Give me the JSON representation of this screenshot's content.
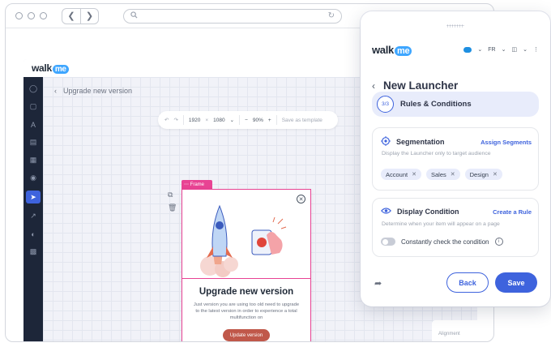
{
  "browser": {
    "url": ""
  },
  "app": {
    "logo_prefix": "walk",
    "logo_suffix": "me",
    "breadcrumb": "Upgrade new version",
    "toolbar": {
      "width": "1920",
      "times": "×",
      "height": "1080",
      "zoom": "90%",
      "save_template": "Save as template"
    },
    "frame_tag": "Frame",
    "card": {
      "title": "Upgrade new version",
      "body": "Just version you are using too old need to upgrade to the latest version in order to experience a total multifunction on",
      "button": "Update version"
    },
    "property_panel": {
      "alignment_label": "Alignment"
    }
  },
  "panel": {
    "logo_prefix": "walk",
    "logo_suffix": "me",
    "language": "FR",
    "title": "New Launcher",
    "step": {
      "counter": "3/3",
      "label": "Rules & Conditions"
    },
    "segmentation": {
      "title": "Segmentation",
      "action": "Assign Segments",
      "description": "Display the Launcher only to target audience",
      "tags": [
        "Account",
        "Sales",
        "Design"
      ]
    },
    "display_condition": {
      "title": "Display Condition",
      "action": "Create a Rule",
      "description": "Determine when your item will appear on a page",
      "toggle_label": "Constantly check the condition",
      "toggle_on": false
    },
    "buttons": {
      "back": "Back",
      "save": "Save"
    }
  },
  "colors": {
    "accent": "#3e63dd",
    "frame": "#e84393",
    "sidebar": "#1d2639",
    "cta": "#c0584a"
  }
}
